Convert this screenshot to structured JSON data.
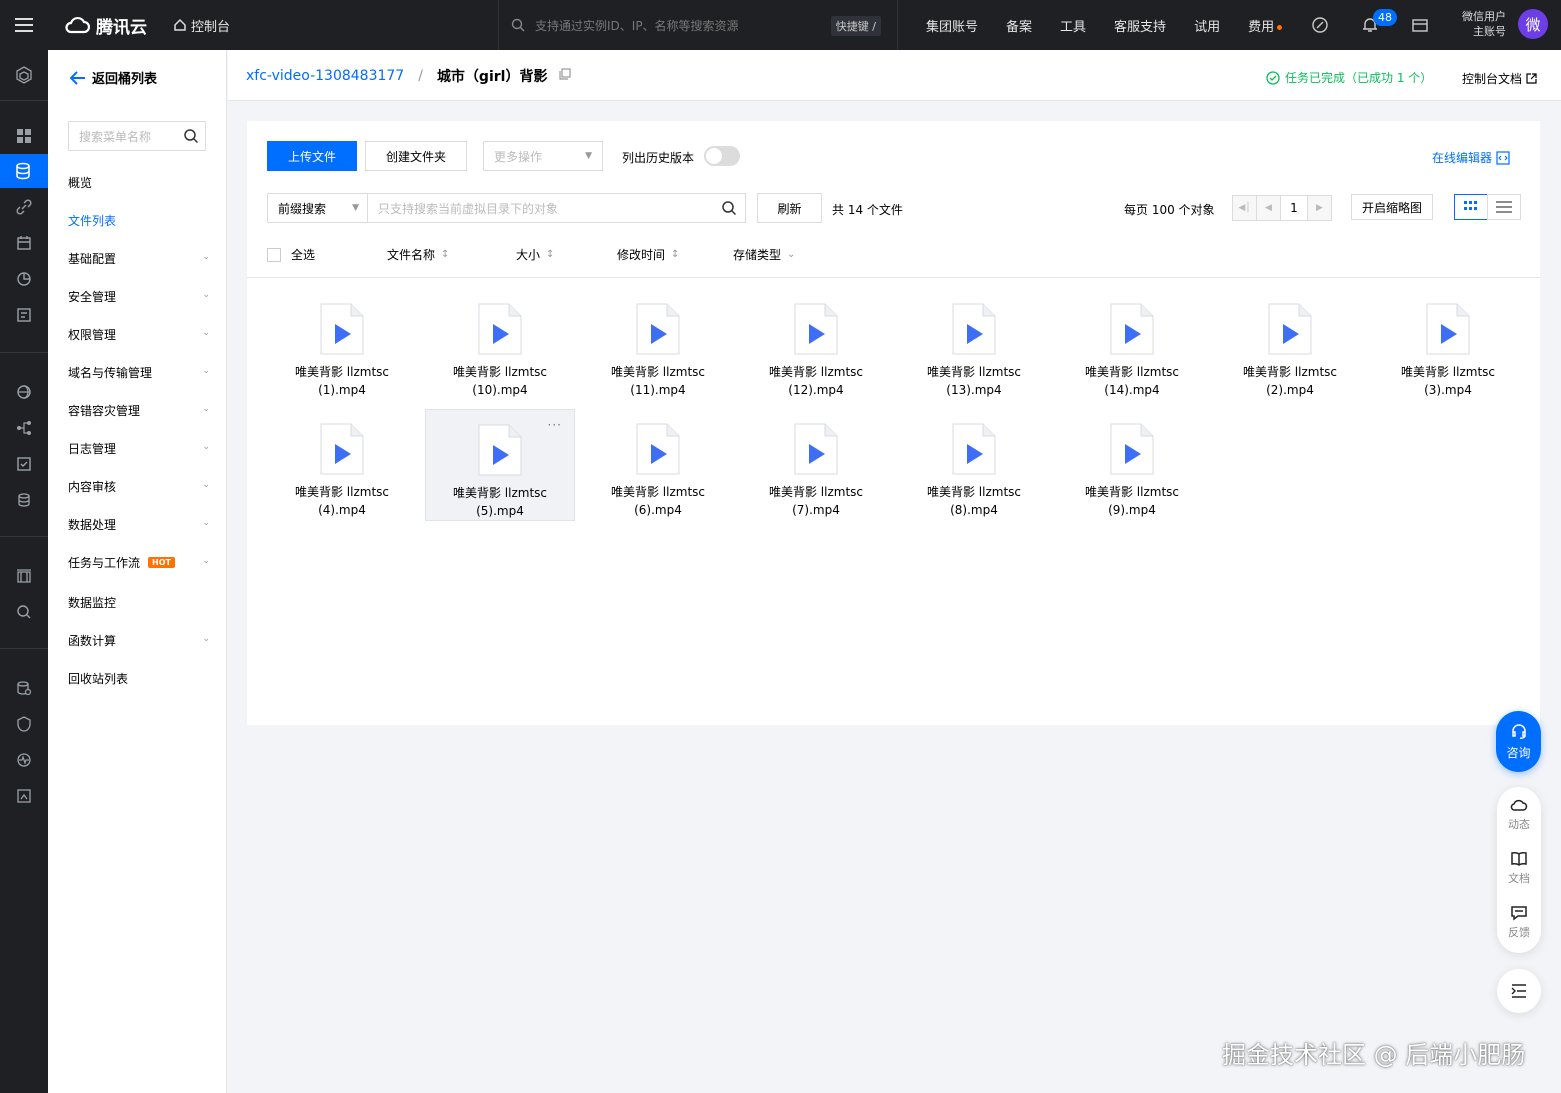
{
  "topbar": {
    "logo_text": "腾讯云",
    "console_label": "控制台",
    "search_placeholder": "支持通过实例ID、IP、名称等搜索资源",
    "shortcut_label": "快捷键 /",
    "nav": [
      "集团账号",
      "备案",
      "工具",
      "客服支持",
      "试用",
      "费用"
    ],
    "notification_count": "48",
    "user_name": "微信用户",
    "user_role": "主账号",
    "avatar_text": "微"
  },
  "sidebar": {
    "back_label": "返回桶列表",
    "search_placeholder": "搜索菜单名称",
    "items": [
      {
        "label": "概览",
        "chevron": false,
        "active": false
      },
      {
        "label": "文件列表",
        "chevron": false,
        "active": true
      },
      {
        "label": "基础配置",
        "chevron": true,
        "active": false
      },
      {
        "label": "安全管理",
        "chevron": true,
        "active": false
      },
      {
        "label": "权限管理",
        "chevron": true,
        "active": false
      },
      {
        "label": "域名与传输管理",
        "chevron": true,
        "active": false
      },
      {
        "label": "容错容灾管理",
        "chevron": true,
        "active": false
      },
      {
        "label": "日志管理",
        "chevron": true,
        "active": false
      },
      {
        "label": "内容审核",
        "chevron": true,
        "active": false
      },
      {
        "label": "数据处理",
        "chevron": true,
        "active": false
      },
      {
        "label": "任务与工作流",
        "chevron": true,
        "active": false,
        "badge": "HOT"
      },
      {
        "label": "数据监控",
        "chevron": false,
        "active": false
      },
      {
        "label": "函数计算",
        "chevron": true,
        "active": false
      },
      {
        "label": "回收站列表",
        "chevron": false,
        "active": false
      }
    ]
  },
  "header": {
    "bucket_link": "xfc-video-1308483177",
    "separator": "/",
    "current_folder": "城市（girl）背影",
    "task_status": "任务已完成（已成功 1 个）",
    "doc_link": "控制台文档"
  },
  "toolbar": {
    "upload_label": "上传文件",
    "create_folder_label": "创建文件夹",
    "more_ops_label": "更多操作",
    "history_label": "列出历史版本",
    "editor_label": "在线编辑器",
    "prefix_search_label": "前缀搜索",
    "search_placeholder": "只支持搜索当前虚拟目录下的对象",
    "refresh_label": "刷新",
    "file_count": "共 14 个文件",
    "per_page": "每页 100 个对象",
    "page_number": "1",
    "thumbnail_label": "开启缩略图"
  },
  "columns": {
    "select_all": "全选",
    "name": "文件名称",
    "size": "大小",
    "modified": "修改时间",
    "storage": "存储类型"
  },
  "files": [
    {
      "line1": "唯美背影 llzmtsc",
      "line2": "(1).mp4"
    },
    {
      "line1": "唯美背影 llzmtsc",
      "line2": "(10).mp4"
    },
    {
      "line1": "唯美背影 llzmtsc",
      "line2": "(11).mp4"
    },
    {
      "line1": "唯美背影 llzmtsc",
      "line2": "(12).mp4"
    },
    {
      "line1": "唯美背影 llzmtsc",
      "line2": "(13).mp4"
    },
    {
      "line1": "唯美背影 llzmtsc",
      "line2": "(14).mp4"
    },
    {
      "line1": "唯美背影 llzmtsc",
      "line2": "(2).mp4"
    },
    {
      "line1": "唯美背影 llzmtsc",
      "line2": "(3).mp4"
    },
    {
      "line1": "唯美背影 llzmtsc",
      "line2": "(4).mp4"
    },
    {
      "line1": "唯美背影 llzmtsc",
      "line2": "(5).mp4"
    },
    {
      "line1": "唯美背影 llzmtsc",
      "line2": "(6).mp4"
    },
    {
      "line1": "唯美背影 llzmtsc",
      "line2": "(7).mp4"
    },
    {
      "line1": "唯美背影 llzmtsc",
      "line2": "(8).mp4"
    },
    {
      "line1": "唯美背影 llzmtsc",
      "line2": "(9).mp4"
    }
  ],
  "float": {
    "consult_label": "咨询",
    "news_label": "动态",
    "docs_label": "文档",
    "feedback_label": "反馈"
  },
  "watermark": "掘金技术社区 @ 后端小肥肠",
  "colors": {
    "accent": "#006eff",
    "topbar": "#1e2024",
    "success": "#0abf5b",
    "hot": "#ff7200"
  }
}
